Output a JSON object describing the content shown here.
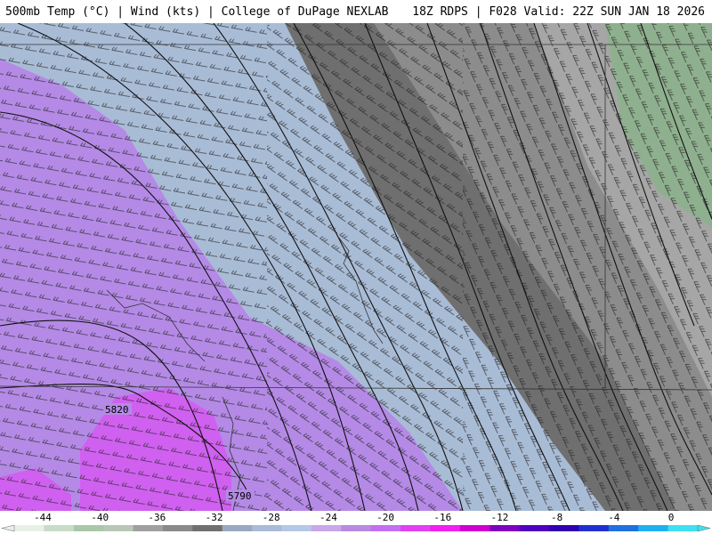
{
  "header": {
    "left_title": "500mb Temp (°C) | Wind (kts) | College of DuPage NEXLAB",
    "right_title": "18Z RDPS | F028 Valid: 22Z SUN JAN 18 2026"
  },
  "contour_labels": [
    "5820",
    "5790"
  ],
  "colorbar": {
    "ticks": [
      "-44",
      "-40",
      "-36",
      "-32",
      "-28",
      "-24",
      "-20",
      "-16",
      "-12",
      "-8",
      "-4",
      "0"
    ],
    "colors": [
      "#e8f0e8",
      "#c8dcc8",
      "#a8c8a8",
      "#b8c8b8",
      "#a0a0a0",
      "#8a8a8a",
      "#707070",
      "#9aa8c0",
      "#aabbd8",
      "#b5c8e8",
      "#c8a8e8",
      "#b88ae0",
      "#c070f0",
      "#e040f0",
      "#f020f0",
      "#d000d0",
      "#8000c0",
      "#5000c0",
      "#3000b0",
      "#2030d0",
      "#2070e0",
      "#20b0f0",
      "#40e0f0"
    ]
  },
  "map_fill_colors": {
    "green": "#8fb08f",
    "gray_light": "#a6a6a6",
    "gray_mid": "#8c8c8c",
    "gray_dark": "#6f6f6f",
    "blue_gray": "#a9bcd6",
    "lavender": "#b48ae6",
    "magenta": "#d060f0"
  }
}
